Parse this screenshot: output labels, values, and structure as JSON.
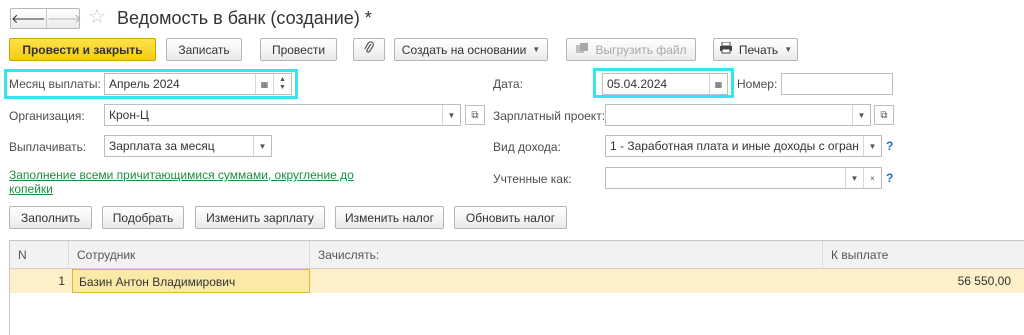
{
  "header": {
    "title": "Ведомость в банк (создание) *",
    "back_icon": "arrow-left-icon",
    "forward_icon": "arrow-right-icon",
    "favorite_icon": "star-icon"
  },
  "toolbar": {
    "post_close": "Провести и закрыть",
    "save": "Записать",
    "post": "Провести",
    "create_based": "Создать на основании",
    "export_file": "Выгрузить файл",
    "print": "Печать"
  },
  "form": {
    "month_label": "Месяц выплаты:",
    "month_value": "Апрель 2024",
    "org_label": "Организация:",
    "org_value": "Крон-Ц",
    "pay_label": "Выплачивать:",
    "pay_value": "Зарплата за месяц",
    "date_label": "Дата:",
    "date_value": "05.04.2024",
    "number_label": "Номер:",
    "number_value": "",
    "salary_project_label": "Зарплатный проект:",
    "salary_project_value": "",
    "income_type_label": "Вид дохода:",
    "income_type_value": "1 - Заработная плата и иные доходы с огран",
    "accounted_as_label": "Учтенные как:",
    "accounted_as_value": "",
    "help": "?"
  },
  "fill_link": "Заполнение всеми причитающимися суммами, округление до копейки",
  "actions": {
    "fill": "Заполнить",
    "select": "Подобрать",
    "change_salary": "Изменить зарплату",
    "change_tax": "Изменить налог",
    "update_tax": "Обновить налог"
  },
  "table": {
    "columns": [
      "N",
      "Сотрудник",
      "Зачислять:",
      "К выплате"
    ],
    "rows": [
      {
        "n": "1",
        "employee": "Базин Антон Владимирович",
        "credit": "",
        "amount": "56 550,00"
      }
    ]
  }
}
